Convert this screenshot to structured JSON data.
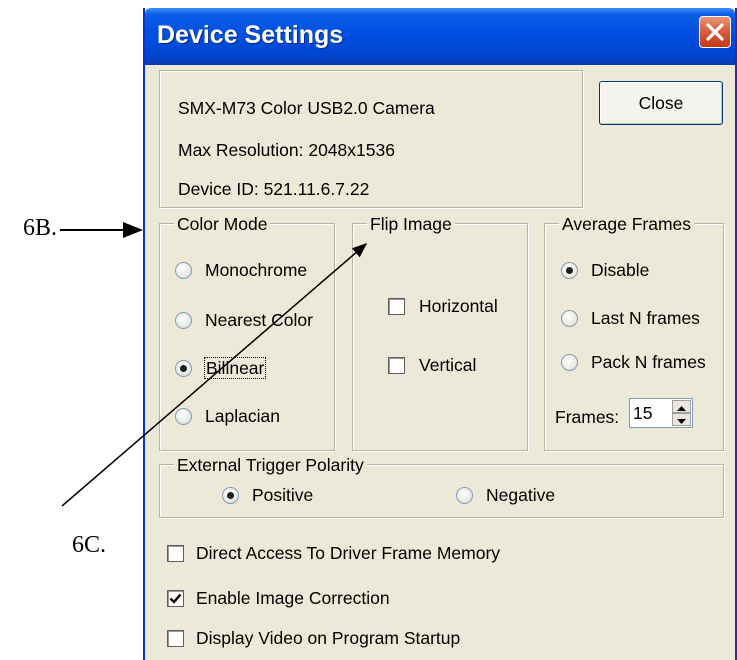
{
  "window": {
    "title": "Device Settings"
  },
  "device_info": {
    "name": "SMX-M73 Color USB2.0 Camera",
    "max_resolution": "Max Resolution: 2048x1536",
    "device_id": "Device ID: 521.11.6.7.22"
  },
  "buttons": {
    "close": "Close"
  },
  "color_mode": {
    "legend": "Color Mode",
    "options": [
      "Monochrome",
      "Nearest Color",
      "Bilinear",
      "Laplacian"
    ],
    "selected": "Bilinear"
  },
  "flip_image": {
    "legend": "Flip Image",
    "horizontal": "Horizontal",
    "vertical": "Vertical",
    "horizontal_checked": false,
    "vertical_checked": false
  },
  "average_frames": {
    "legend": "Average Frames",
    "options": [
      "Disable",
      "Last N frames",
      "Pack N frames"
    ],
    "selected": "Disable",
    "frames_label": "Frames:",
    "frames_value": "15"
  },
  "trigger": {
    "legend": "External Trigger Polarity",
    "positive": "Positive",
    "negative": "Negative",
    "selected": "Positive"
  },
  "options": {
    "direct_access": "Direct Access To Driver Frame Memory",
    "image_correction": "Enable Image Correction",
    "display_video": "Display Video on Program Startup",
    "direct_access_checked": false,
    "image_correction_checked": true,
    "display_video_checked": false
  },
  "annotations": {
    "label_6b": "6B.",
    "label_6c": "6C."
  }
}
